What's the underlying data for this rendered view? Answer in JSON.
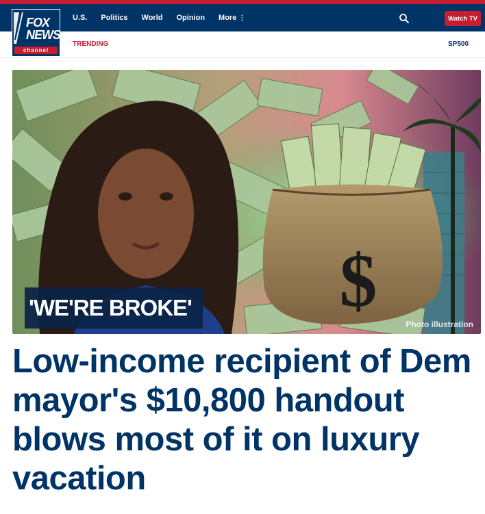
{
  "brand": {
    "line1": "FOX",
    "line2": "NEWS",
    "line3": "channel"
  },
  "nav": {
    "items": [
      "U.S.",
      "Politics",
      "World",
      "Opinion",
      "More"
    ],
    "watch_label": "Watch TV"
  },
  "subnav": {
    "trending_label": "TRENDING",
    "ticker_label": "SP500"
  },
  "hero": {
    "kicker": "'WE'RE BROKE'",
    "credit": "Photo illustration"
  },
  "article": {
    "headline": "Low-income recipient of Dem mayor's $10,800 handout blows most of it on luxury vacation"
  },
  "colors": {
    "navy": "#003366",
    "red": "#c41e30"
  }
}
